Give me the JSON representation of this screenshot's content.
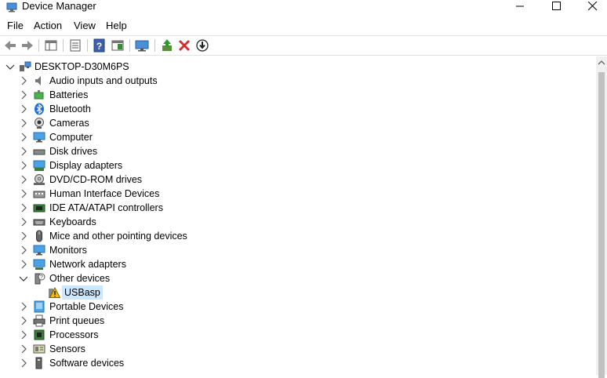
{
  "window": {
    "title": "Device Manager"
  },
  "menu": {
    "items": [
      "File",
      "Action",
      "View",
      "Help"
    ]
  },
  "toolbar": {
    "buttons": [
      "back-icon",
      "forward-icon",
      "properties-icon",
      "list-icon",
      "help-icon",
      "action-pane-icon",
      "monitor-icon",
      "update-driver-icon",
      "uninstall-icon",
      "download-icon"
    ]
  },
  "tree": {
    "root": "DESKTOP-D30M6PS",
    "categories": [
      "Audio inputs and outputs",
      "Batteries",
      "Bluetooth",
      "Cameras",
      "Computer",
      "Disk drives",
      "Display adapters",
      "DVD/CD-ROM drives",
      "Human Interface Devices",
      "IDE ATA/ATAPI controllers",
      "Keyboards",
      "Mice and other pointing devices",
      "Monitors",
      "Network adapters",
      "Other devices",
      "USBasp",
      "Portable Devices",
      "Print queues",
      "Processors",
      "Sensors",
      "Software devices"
    ]
  },
  "colors": {
    "selection": "#cce8ff",
    "accent": "#0078d7",
    "error": "#d32f2f",
    "warning": "#f0c000"
  }
}
